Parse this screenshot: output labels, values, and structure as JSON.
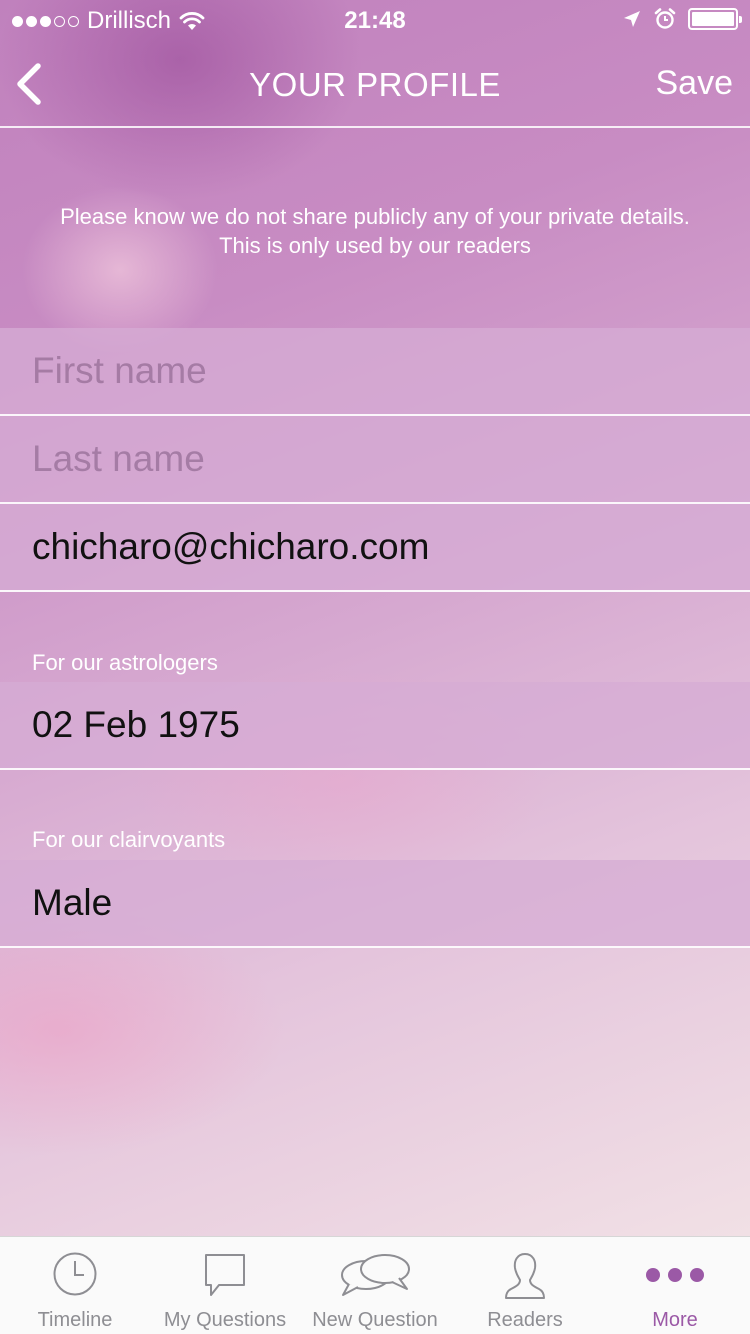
{
  "status_bar": {
    "carrier": "Drillisch",
    "time": "21:48"
  },
  "nav": {
    "title": "YOUR PROFILE",
    "save_label": "Save",
    "back_icon": "chevron-left-icon"
  },
  "privacy_note": {
    "line1": "Please know we do not share publicly any of your private details.",
    "line2": "This is only used by our readers"
  },
  "form": {
    "first_name_placeholder": "First name",
    "last_name_placeholder": "Last name",
    "email_value": "chicharo@chicharo.com",
    "astrologers_label": "For our astrologers",
    "birth_date_value": "02 Feb 1975",
    "clairvoyants_label": "For our clairvoyants",
    "gender_value": "Male"
  },
  "tabs": [
    {
      "label": "Timeline",
      "icon": "clock-icon"
    },
    {
      "label": "My Questions",
      "icon": "speech-bubble-icon"
    },
    {
      "label": "New Question",
      "icon": "chat-bubbles-icon"
    },
    {
      "label": "Readers",
      "icon": "person-icon"
    },
    {
      "label": "More",
      "icon": "more-dots-icon"
    }
  ],
  "colors": {
    "accent": "#9b59a6",
    "tab_inactive": "#8e8e93"
  }
}
